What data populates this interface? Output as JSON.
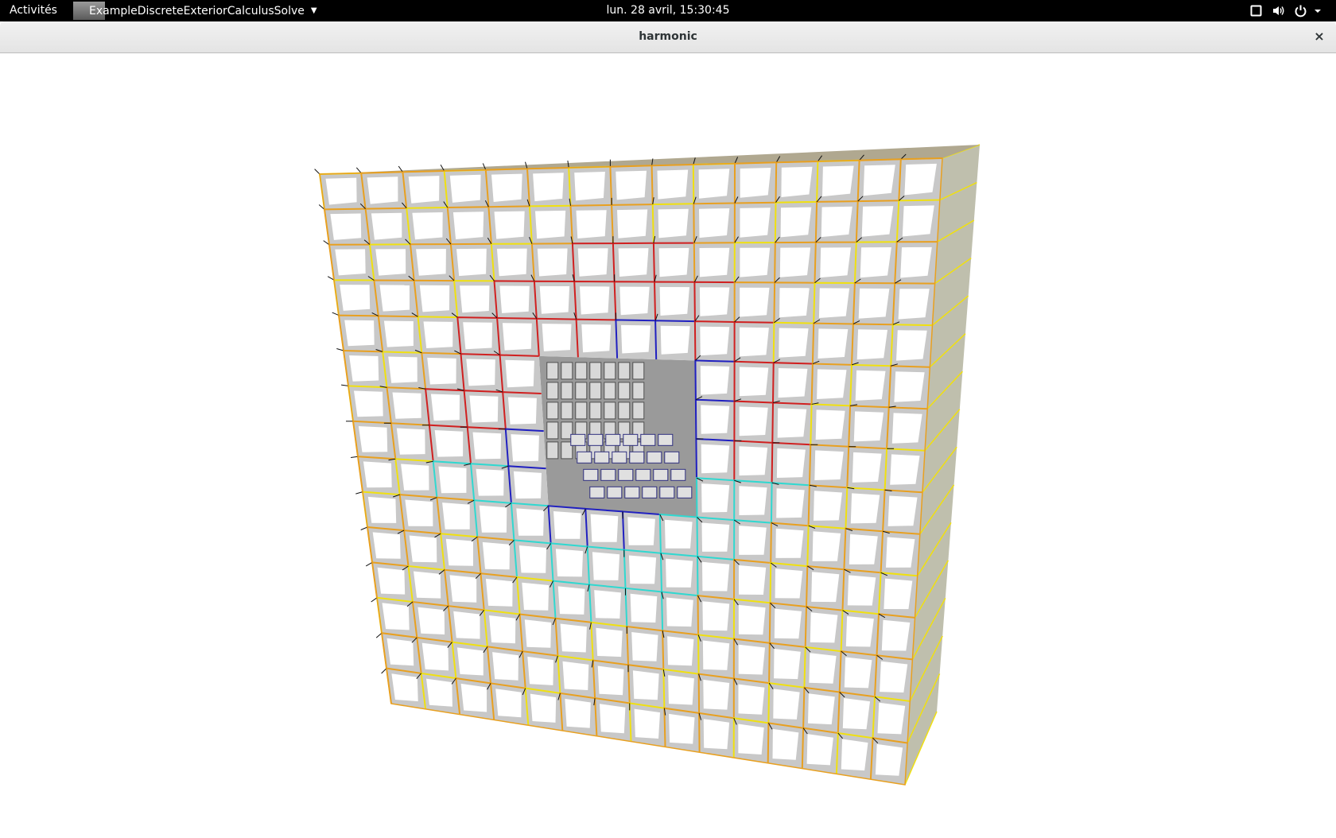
{
  "topbar": {
    "activities_label": "Activités",
    "app_name": "ExampleDiscreteExteriorCalculusSolve",
    "clock": "lun. 28 avril, 15:30:45"
  },
  "window": {
    "title": "harmonic",
    "close_glyph": "×"
  },
  "icons": {
    "system": [
      "display-icon",
      "volume-icon",
      "power-icon"
    ],
    "dropdown": "chevron-down-icon"
  },
  "scene": {
    "grid_cells_per_side": 15,
    "hole_cells": 4,
    "colors": {
      "edge_warm": "#e8a020",
      "edge_red": "#d02020",
      "edge_yellow": "#f0e010",
      "edge_cyan": "#30d8d0",
      "edge_blue": "#2020c0",
      "cell_face": "#ffffff",
      "cell_shadow": "#c8c8c8",
      "side_face": "#8a8a6a",
      "vector": "#111111"
    }
  }
}
